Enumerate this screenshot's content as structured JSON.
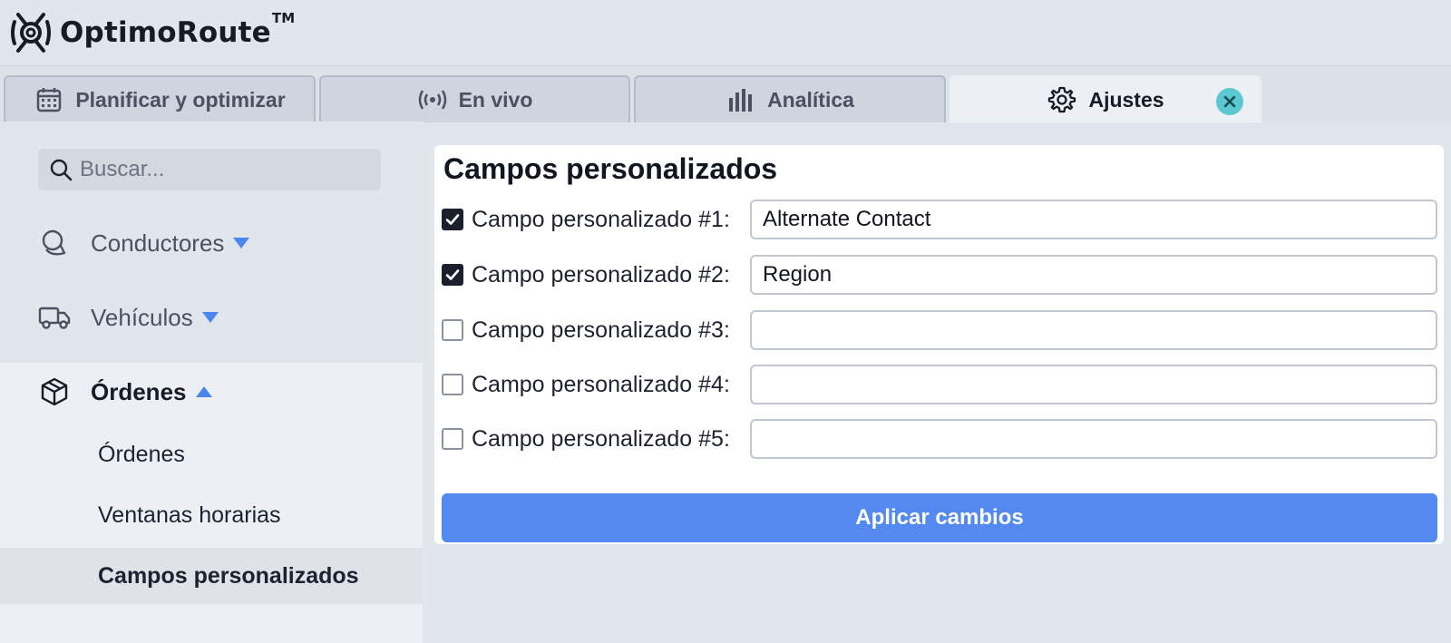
{
  "app": {
    "name": "OptimoRoute",
    "trademark": "TM"
  },
  "tabs": [
    {
      "label": "Planificar y optimizar",
      "icon": "calendar-icon"
    },
    {
      "label": "En vivo",
      "icon": "broadcast-icon"
    },
    {
      "label": "Analítica",
      "icon": "bar-chart-icon"
    },
    {
      "label": "Ajustes",
      "icon": "gear-icon",
      "active": true
    }
  ],
  "sidebar": {
    "search_placeholder": "Buscar...",
    "items": [
      {
        "label": "Conductores",
        "icon": "driver-icon",
        "expanded": false
      },
      {
        "label": "Vehículos",
        "icon": "truck-icon",
        "expanded": false
      },
      {
        "label": "Órdenes",
        "icon": "package-icon",
        "expanded": true
      }
    ],
    "sub_items": [
      {
        "label": "Órdenes"
      },
      {
        "label": "Ventanas horarias"
      },
      {
        "label": "Campos personalizados",
        "selected": true
      }
    ]
  },
  "main": {
    "title": "Campos personalizados",
    "fields": [
      {
        "label": "Campo personalizado #1:",
        "checked": true,
        "value": "Alternate Contact"
      },
      {
        "label": "Campo personalizado #2:",
        "checked": true,
        "value": "Region"
      },
      {
        "label": "Campo personalizado #3:",
        "checked": false,
        "value": ""
      },
      {
        "label": "Campo personalizado #4:",
        "checked": false,
        "value": ""
      },
      {
        "label": "Campo personalizado #5:",
        "checked": false,
        "value": ""
      }
    ],
    "apply_label": "Aplicar cambios"
  },
  "colors": {
    "accent": "#5489f0",
    "caret": "#4b86ee",
    "close_button": "#5cc8cf"
  }
}
